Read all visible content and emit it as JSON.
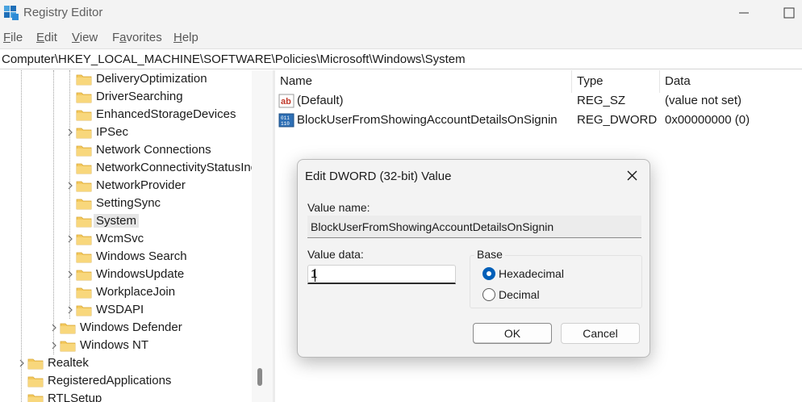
{
  "window": {
    "title": "Registry Editor"
  },
  "menu": {
    "file": {
      "mnemonic": "F",
      "rest": "ile"
    },
    "edit": {
      "mnemonic": "E",
      "rest": "dit"
    },
    "view": {
      "mnemonic": "V",
      "rest": "iew"
    },
    "favorites": {
      "mnemonic": "a",
      "before": "F",
      "rest": "vorites"
    },
    "help": {
      "mnemonic": "H",
      "rest": "elp"
    }
  },
  "address": {
    "path": "Computer\\HKEY_LOCAL_MACHINE\\SOFTWARE\\Policies\\Microsoft\\Windows\\System"
  },
  "tree": {
    "items": [
      {
        "label": "DeliveryOptimization",
        "expandable": false
      },
      {
        "label": "DriverSearching",
        "expandable": false
      },
      {
        "label": "EnhancedStorageDevices",
        "expandable": false
      },
      {
        "label": "IPSec",
        "expandable": true
      },
      {
        "label": "Network Connections",
        "expandable": false
      },
      {
        "label": "NetworkConnectivityStatusInd",
        "expandable": false
      },
      {
        "label": "NetworkProvider",
        "expandable": true
      },
      {
        "label": "SettingSync",
        "expandable": false
      },
      {
        "label": "System",
        "expandable": false,
        "selected": true
      },
      {
        "label": "WcmSvc",
        "expandable": true
      },
      {
        "label": "Windows Search",
        "expandable": false
      },
      {
        "label": "WindowsUpdate",
        "expandable": true
      },
      {
        "label": "WorkplaceJoin",
        "expandable": false
      },
      {
        "label": "WSDAPI",
        "expandable": true
      },
      {
        "label": "Windows Defender",
        "expandable": true
      },
      {
        "label": "Windows NT",
        "expandable": true
      },
      {
        "label": "Realtek",
        "expandable": true
      },
      {
        "label": "RegisteredApplications",
        "expandable": false
      },
      {
        "label": "RTLSetup",
        "expandable": false
      }
    ]
  },
  "list": {
    "headers": {
      "name": "Name",
      "type": "Type",
      "data": "Data"
    },
    "rows": [
      {
        "name": "(Default)",
        "type": "REG_SZ",
        "data": "(value not set)",
        "icon": "string-value-icon"
      },
      {
        "name": "BlockUserFromShowingAccountDetailsOnSignin",
        "type": "REG_DWORD",
        "data": "0x00000000 (0)",
        "icon": "binary-value-icon"
      }
    ]
  },
  "dialog": {
    "title": "Edit DWORD (32-bit) Value",
    "value_name_label": "Value name:",
    "value_name": "BlockUserFromShowingAccountDetailsOnSignin",
    "value_data_label": "Value data:",
    "value_data": "1",
    "base_label": "Base",
    "base_options": [
      {
        "label": "Hexadecimal",
        "checked": true
      },
      {
        "label": "Decimal",
        "checked": false
      }
    ],
    "ok_label": "OK",
    "cancel_label": "Cancel"
  },
  "colors": {
    "accent": "#005fb8",
    "folder": "#f4c95d",
    "chrome": "#f3f3f3"
  }
}
